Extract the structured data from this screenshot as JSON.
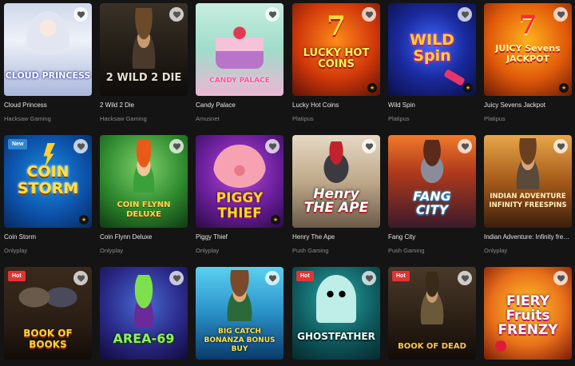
{
  "games": [
    {
      "title": "Cloud Princess",
      "provider": "Hacksaw Gaming",
      "badge": "",
      "logo": "CLOUD PRINCESS",
      "icon": "princess-icon"
    },
    {
      "title": "2 Wild 2 Die",
      "provider": "Hacksaw Gaming",
      "badge": "",
      "logo": "2 WILD 2 DIE",
      "icon": "cowgirl-icon"
    },
    {
      "title": "Candy Palace",
      "provider": "Amusnet",
      "badge": "",
      "logo": "CANDY PALACE",
      "icon": "cake-icon"
    },
    {
      "title": "Lucky Hot Coins",
      "provider": "Platipus",
      "badge": "",
      "logo": "LUCKY HOT COINS",
      "icon": "seven-icon"
    },
    {
      "title": "Wild Spin",
      "provider": "Platipus",
      "badge": "",
      "logo": "WILD Spin",
      "icon": "slot-icon"
    },
    {
      "title": "Juicy Sevens Jackpot",
      "provider": "Platipus",
      "badge": "",
      "logo": "JUICY Sevens JACKPOT",
      "icon": "seven-icon"
    },
    {
      "title": "Coin Storm",
      "provider": "Onlyplay",
      "badge": "New",
      "logo": "COIN STORM",
      "icon": "lightning-icon"
    },
    {
      "title": "Coin Flynn Deluxe",
      "provider": "Onlyplay",
      "badge": "",
      "logo": "COIN FLYNN DELUXE",
      "icon": "leprechaun-icon"
    },
    {
      "title": "Piggy Thief",
      "provider": "Onlyplay",
      "badge": "",
      "logo": "PIGGY THIEF",
      "icon": "pig-icon"
    },
    {
      "title": "Henry The Ape",
      "provider": "Push Gaming",
      "badge": "",
      "logo": "Henry THE APE",
      "icon": "gorilla-icon"
    },
    {
      "title": "Fang City",
      "provider": "Push Gaming",
      "badge": "",
      "logo": "FANG CITY",
      "icon": "wolf-icon"
    },
    {
      "title": "Indian Adventure: Infinity freespins",
      "provider": "Onlyplay",
      "badge": "",
      "logo": "INDIAN ADVENTURE INFINITY FREESPINS",
      "icon": "explorer-icon"
    },
    {
      "title": "",
      "provider": "",
      "badge": "Hot",
      "logo": "BOOK OF BOOKS",
      "icon": "wizard-icon"
    },
    {
      "title": "",
      "provider": "",
      "badge": "",
      "logo": "AREA-69",
      "icon": "alien-icon"
    },
    {
      "title": "",
      "provider": "",
      "badge": "",
      "logo": "BIG CATCH BONANZA BONUS BUY",
      "icon": "fisherman-icon"
    },
    {
      "title": "",
      "provider": "",
      "badge": "Hot",
      "logo": "GHOSTFATHER",
      "icon": "ghost-icon"
    },
    {
      "title": "",
      "provider": "",
      "badge": "Hot",
      "logo": "BOOK OF DEAD",
      "icon": "book-icon"
    },
    {
      "title": "",
      "provider": "",
      "badge": "",
      "logo": "FIERY Fruits FRENZY",
      "icon": "fruit-icon"
    }
  ],
  "theme": {
    "background": "#141414",
    "new_badge": "#2f86d6",
    "hot_badge": "#e03535",
    "title_color": "#e6e6e6",
    "provider_color": "#8a8a8a"
  }
}
